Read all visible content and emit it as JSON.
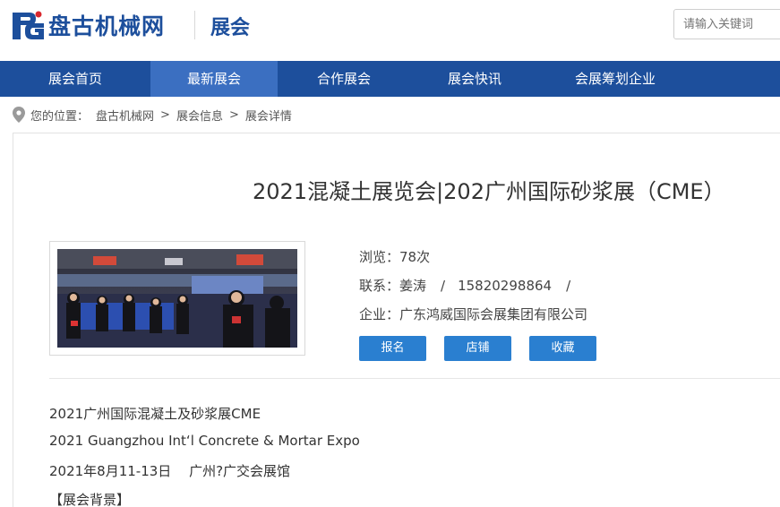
{
  "header": {
    "logo_text": "盘古机械网",
    "section_name": "展会",
    "search_placeholder": "请输入关键词"
  },
  "nav": {
    "items": [
      {
        "label": "展会首页"
      },
      {
        "label": "最新展会"
      },
      {
        "label": "合作展会"
      },
      {
        "label": "展会快讯"
      },
      {
        "label": "会展筹划企业"
      }
    ],
    "active_index": 1
  },
  "breadcrumb": {
    "prefix": "您的位置：",
    "items": [
      "盘古机械网",
      "展会信息",
      "展会详情"
    ],
    "separator": ">"
  },
  "exhibition": {
    "title": "2021混凝土展览会|202广州国际砂浆展（CME）",
    "views_label": "浏览：",
    "views_value": "78次",
    "contact_label": "联系：",
    "contact_name": "姜涛",
    "contact_phone": "15820298864",
    "company_label": "企业：",
    "company_name": "广东鸿威国际会展集团有限公司",
    "buttons": {
      "register": "报名",
      "shop": "店铺",
      "favorite": "收藏"
    }
  },
  "body": {
    "lines": [
      "2021广州国际混凝土及砂浆展CME",
      "2021 Guangzhou Int‘l Concrete & Mortar Expo",
      "2021年8月11-13日　 广州?广交会展馆",
      "【展会背景】"
    ]
  },
  "colors": {
    "brand_blue": "#1d4f9c",
    "nav_active": "#3b6fc1",
    "button_blue": "#2a7fd0",
    "logo_red": "#d9272d"
  },
  "icons": {
    "location": "map-pin-icon",
    "logo": "pg-logo-icon"
  }
}
